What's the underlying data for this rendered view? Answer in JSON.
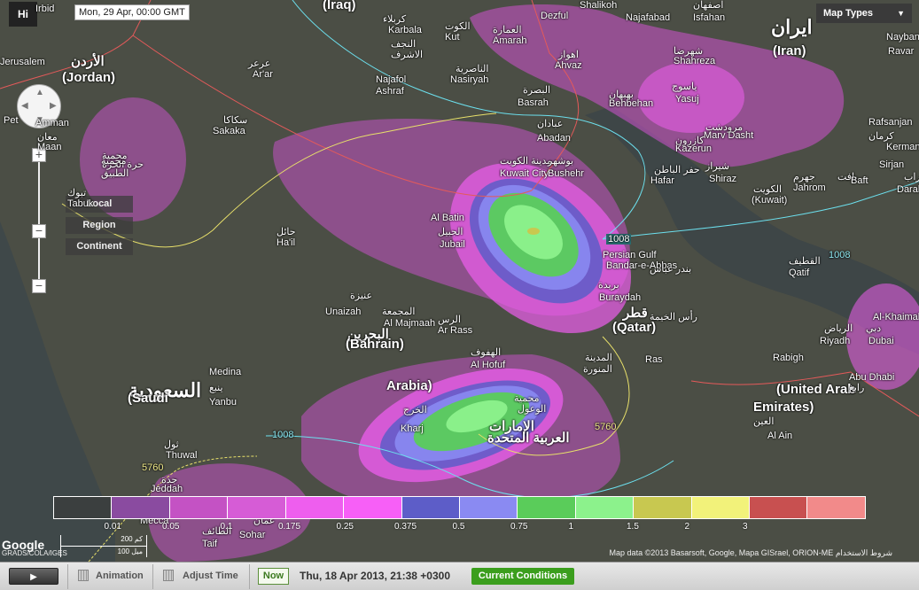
{
  "top": {
    "logo": "Hi",
    "timestamp": "Mon, 29 Apr, 00:00 GMT",
    "map_types": "Map Types"
  },
  "controls": {
    "zoom_in": "+",
    "zoom_out": "−",
    "zoom_mid": "−",
    "levels": [
      "Local",
      "Region",
      "Continent"
    ]
  },
  "places": [
    {
      "text": "Irbid",
      "cls": ""
    },
    {
      "text": "(Iraq)",
      "cls": "big"
    },
    {
      "text": "كربلاء",
      "cls": ""
    },
    {
      "text": "Karbala",
      "cls": ""
    },
    {
      "text": "الكوت",
      "cls": ""
    },
    {
      "text": "Kut",
      "cls": ""
    },
    {
      "text": "النجف",
      "cls": ""
    },
    {
      "text": "الاشرف",
      "cls": ""
    },
    {
      "text": "Najafol",
      "cls": ""
    },
    {
      "text": "Ashraf",
      "cls": ""
    },
    {
      "text": "عرعر",
      "cls": ""
    },
    {
      "text": "Ar'ar",
      "cls": ""
    },
    {
      "text": "الأردن",
      "cls": "big"
    },
    {
      "text": "(Jordan)",
      "cls": "big"
    },
    {
      "text": "Jerusalem",
      "cls": ""
    },
    {
      "text": "Amman",
      "cls": ""
    },
    {
      "text": "Pet",
      "cls": ""
    },
    {
      "text": "معان",
      "cls": ""
    },
    {
      "text": "Maan",
      "cls": ""
    },
    {
      "text": "محمية",
      "cls": ""
    },
    {
      "text": "حرة الحرة",
      "cls": ""
    },
    {
      "text": "سكاكا",
      "cls": ""
    },
    {
      "text": "Sakaka",
      "cls": ""
    },
    {
      "text": "محمية",
      "cls": ""
    },
    {
      "text": "الطبيق",
      "cls": ""
    },
    {
      "text": "تبوك",
      "cls": ""
    },
    {
      "text": "Tabuk",
      "cls": ""
    },
    {
      "text": "حائل",
      "cls": ""
    },
    {
      "text": "Ha'il",
      "cls": ""
    },
    {
      "text": "Dezful",
      "cls": ""
    },
    {
      "text": "Shalikoh",
      "cls": ""
    },
    {
      "text": "Najafabad",
      "cls": ""
    },
    {
      "text": "اصفهان",
      "cls": ""
    },
    {
      "text": "Isfahan",
      "cls": ""
    },
    {
      "text": "العمارة",
      "cls": ""
    },
    {
      "text": "Amarah",
      "cls": ""
    },
    {
      "text": "الناصرية",
      "cls": ""
    },
    {
      "text": "Nasiryah",
      "cls": ""
    },
    {
      "text": "اهواز",
      "cls": ""
    },
    {
      "text": "Ahvaz",
      "cls": ""
    },
    {
      "text": "ایران",
      "cls": "huge"
    },
    {
      "text": "(Iran)",
      "cls": "big"
    },
    {
      "text": "شهرضا",
      "cls": ""
    },
    {
      "text": "Shahreza",
      "cls": ""
    },
    {
      "text": "البصرة",
      "cls": ""
    },
    {
      "text": "Basrah",
      "cls": ""
    },
    {
      "text": "بهبهان",
      "cls": ""
    },
    {
      "text": "Behbehan",
      "cls": ""
    },
    {
      "text": "یاسوج",
      "cls": ""
    },
    {
      "text": "Yasuj",
      "cls": ""
    },
    {
      "text": "مرودشت",
      "cls": ""
    },
    {
      "text": "Marv Dasht",
      "cls": ""
    },
    {
      "text": "كازرون",
      "cls": ""
    },
    {
      "text": "Kazerun",
      "cls": ""
    },
    {
      "text": "شيراز",
      "cls": ""
    },
    {
      "text": "Shiraz",
      "cls": ""
    },
    {
      "text": "عبادان",
      "cls": ""
    },
    {
      "text": "Abadan",
      "cls": ""
    },
    {
      "text": "Naybandan",
      "cls": ""
    },
    {
      "text": "Ravar",
      "cls": ""
    },
    {
      "text": "Rafsanjan",
      "cls": ""
    },
    {
      "text": "كرمان",
      "cls": ""
    },
    {
      "text": "Kerman",
      "cls": ""
    },
    {
      "text": "Sirjan",
      "cls": ""
    },
    {
      "text": "بافت",
      "cls": ""
    },
    {
      "text": "Baft",
      "cls": ""
    },
    {
      "text": "داراب",
      "cls": ""
    },
    {
      "text": "Darab",
      "cls": ""
    },
    {
      "text": "جهرم",
      "cls": ""
    },
    {
      "text": "Jahrom",
      "cls": ""
    },
    {
      "text": "الكويت",
      "cls": ""
    },
    {
      "text": "(Kuwait)",
      "cls": ""
    },
    {
      "text": "مدينة الكويت",
      "cls": ""
    },
    {
      "text": "Kuwait City",
      "cls": ""
    },
    {
      "text": "بوشهر",
      "cls": ""
    },
    {
      "text": "Bushehr",
      "cls": ""
    },
    {
      "text": "حفر الباطن",
      "cls": ""
    },
    {
      "text": "Hafar",
      "cls": ""
    },
    {
      "text": "Al Batin",
      "cls": ""
    },
    {
      "text": "الجبيل",
      "cls": ""
    },
    {
      "text": "Jubail",
      "cls": ""
    },
    {
      "text": "Persian Gulf",
      "cls": ""
    },
    {
      "text": "Bandar-e-Abbas",
      "cls": ""
    },
    {
      "text": "بندر عباس",
      "cls": ""
    },
    {
      "text": "القطيف",
      "cls": ""
    },
    {
      "text": "Qatif",
      "cls": ""
    },
    {
      "text": "بريدة",
      "cls": ""
    },
    {
      "text": "Buraydah",
      "cls": ""
    },
    {
      "text": "عنيزة",
      "cls": ""
    },
    {
      "text": "Unaizah",
      "cls": ""
    },
    {
      "text": "المجمعة",
      "cls": ""
    },
    {
      "text": "Al Majmaah",
      "cls": ""
    },
    {
      "text": "الرس",
      "cls": ""
    },
    {
      "text": "Ar Rass",
      "cls": ""
    },
    {
      "text": "البحرين",
      "cls": "big"
    },
    {
      "text": "(Bahrain)",
      "cls": "big"
    },
    {
      "text": "قطر",
      "cls": "big"
    },
    {
      "text": "(Qatar)",
      "cls": "big"
    },
    {
      "text": "رأس الخيمة",
      "cls": ""
    },
    {
      "text": "Ras",
      "cls": ""
    },
    {
      "text": "Al-Khaimah",
      "cls": ""
    },
    {
      "text": "دبي",
      "cls": ""
    },
    {
      "text": "Dubai",
      "cls": ""
    },
    {
      "text": "الرياض",
      "cls": ""
    },
    {
      "text": "Riyadh",
      "cls": ""
    },
    {
      "text": "الهفوف",
      "cls": ""
    },
    {
      "text": "Al Hofuf",
      "cls": ""
    },
    {
      "text": "المدينة",
      "cls": ""
    },
    {
      "text": "المنورة",
      "cls": ""
    },
    {
      "text": "Medina",
      "cls": ""
    },
    {
      "text": "ينبع",
      "cls": ""
    },
    {
      "text": "Yanbu",
      "cls": ""
    },
    {
      "text": "السعودية",
      "cls": "huge"
    },
    {
      "text": "(Saudi",
      "cls": "big"
    },
    {
      "text": "Arabia)",
      "cls": "big"
    },
    {
      "text": "الخرج",
      "cls": ""
    },
    {
      "text": "Kharj",
      "cls": ""
    },
    {
      "text": "محمية",
      "cls": ""
    },
    {
      "text": "الوعول",
      "cls": ""
    },
    {
      "text": "الإمارات",
      "cls": "big"
    },
    {
      "text": "العربية المتحدة",
      "cls": "big"
    },
    {
      "text": "(United Arab",
      "cls": "big"
    },
    {
      "text": "Emirates)",
      "cls": "big"
    },
    {
      "text": "العين",
      "cls": ""
    },
    {
      "text": "Al Ain",
      "cls": ""
    },
    {
      "text": "Abu Dhabi",
      "cls": ""
    },
    {
      "text": "رابغ",
      "cls": ""
    },
    {
      "text": "Rabigh",
      "cls": ""
    },
    {
      "text": "ثول",
      "cls": ""
    },
    {
      "text": "Thuwal",
      "cls": ""
    },
    {
      "text": "جدة",
      "cls": ""
    },
    {
      "text": "Jeddah",
      "cls": ""
    },
    {
      "text": "مكة",
      "cls": ""
    },
    {
      "text": "Mecca",
      "cls": ""
    },
    {
      "text": "الطائف",
      "cls": ""
    },
    {
      "text": "Taif",
      "cls": ""
    },
    {
      "text": "عمان",
      "cls": ""
    },
    {
      "text": "Sohar",
      "cls": ""
    }
  ],
  "isobars": [
    "1008",
    "1008",
    "1008",
    "5760",
    "5760"
  ],
  "legend": {
    "colors": [
      "#3b3f3f",
      "#8a4ba0",
      "#c452c4",
      "#d65cd6",
      "#ee5eee",
      "#f75ff7",
      "#5d5dc8",
      "#8a8af2",
      "#5acc5a",
      "#8cf28c",
      "#c8c850",
      "#f2f27a",
      "#c85050",
      "#f28a8a"
    ],
    "ticks": [
      "0.01",
      "0.05",
      "0.1",
      "0.175",
      "0.25",
      "0.375",
      "0.5",
      "0.75",
      "1",
      "1.5",
      "2",
      "3"
    ]
  },
  "map_footer": {
    "google": "Google",
    "gadsdo": "GRADS/COLA/IGES",
    "scale_km": "200 كم",
    "scale_mi": "100 ميل",
    "attribution": "Map data ©2013 Basarsoft, Google, Mapa GISrael, ORION-ME",
    "terms": "شروط الاستخدام"
  },
  "bottom_bar": {
    "play": "▶",
    "animation": "Animation",
    "adjust_time": "Adjust Time",
    "now": "Now",
    "datetime": "Thu, 18 Apr 2013, 21:38 +0300",
    "current_conditions": "Current Conditions"
  }
}
